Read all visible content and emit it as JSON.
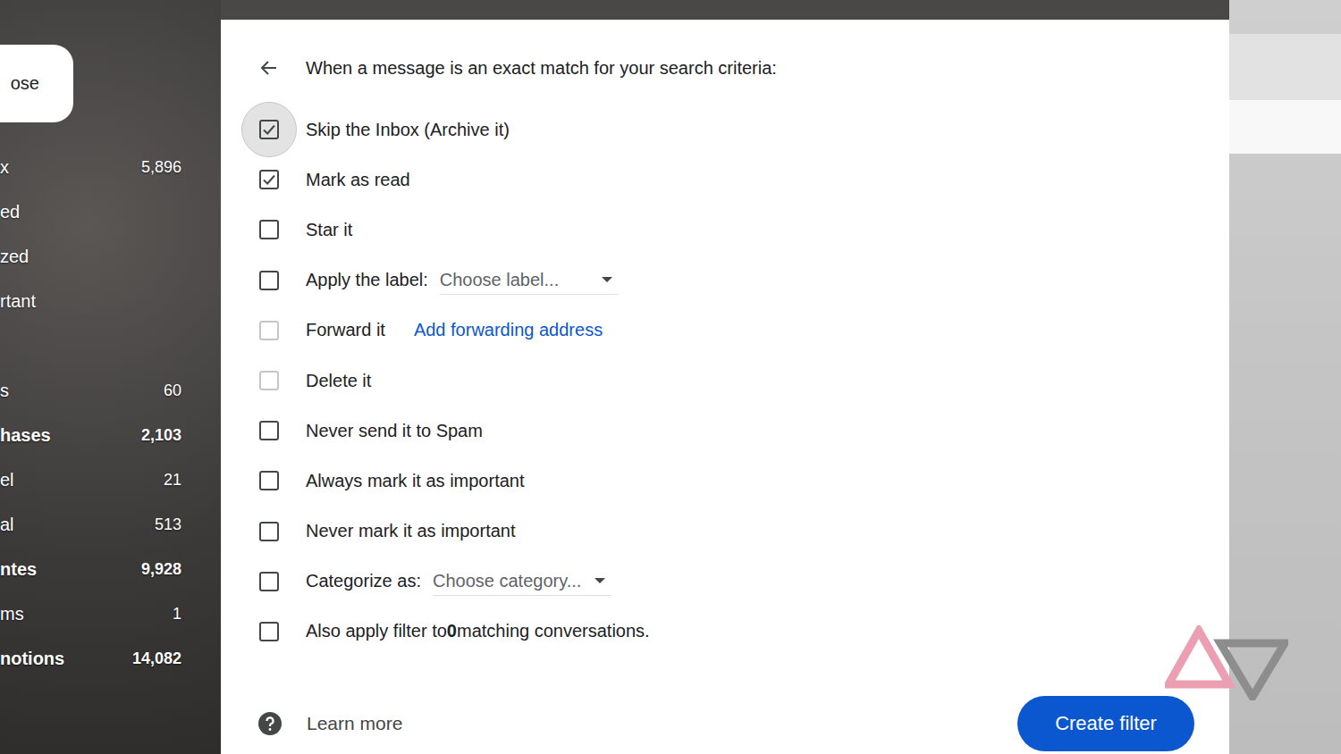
{
  "sidebar": {
    "compose": "ose",
    "items": [
      {
        "label": "x",
        "count": "5,896",
        "bold": false
      },
      {
        "label": "ed",
        "count": "",
        "bold": false
      },
      {
        "label": "zed",
        "count": "",
        "bold": false
      },
      {
        "label": "rtant",
        "count": "",
        "bold": false
      }
    ],
    "labels": [
      {
        "label": "s",
        "count": "60",
        "bold": false
      },
      {
        "label": "hases",
        "count": "2,103",
        "bold": true
      },
      {
        "label": "el",
        "count": "21",
        "bold": false
      },
      {
        "label": "al",
        "count": "513",
        "bold": false
      },
      {
        "label": "ntes",
        "count": "9,928",
        "bold": true
      },
      {
        "label": "ms",
        "count": "1",
        "bold": false
      },
      {
        "label": "notions",
        "count": "14,082",
        "bold": true
      }
    ]
  },
  "dialog": {
    "heading": "When a message is an exact match for your search criteria:",
    "actions": [
      {
        "kind": "checkbox",
        "label": "Skip the Inbox (Archive it)",
        "checked": true,
        "disabled": false,
        "hovered": true
      },
      {
        "kind": "checkbox",
        "label": "Mark as read",
        "checked": true,
        "disabled": false,
        "hovered": false
      },
      {
        "kind": "checkbox",
        "label": "Star it",
        "checked": false,
        "disabled": false,
        "hovered": false
      },
      {
        "kind": "select",
        "label": "Apply the label:",
        "value": "Choose label...",
        "checked": false,
        "disabled": false,
        "hovered": false
      },
      {
        "kind": "link",
        "label": "Forward it",
        "link": "Add forwarding address",
        "checked": false,
        "disabled": true,
        "hovered": false
      },
      {
        "kind": "checkbox",
        "label": "Delete it",
        "checked": false,
        "disabled": true,
        "hovered": false
      },
      {
        "kind": "checkbox",
        "label": "Never send it to Spam",
        "checked": false,
        "disabled": false,
        "hovered": false
      },
      {
        "kind": "checkbox",
        "label": "Always mark it as important",
        "checked": false,
        "disabled": false,
        "hovered": false
      },
      {
        "kind": "checkbox",
        "label": "Never mark it as important",
        "checked": false,
        "disabled": false,
        "hovered": false
      },
      {
        "kind": "select",
        "label": "Categorize as:",
        "value": "Choose category...",
        "checked": false,
        "disabled": false,
        "hovered": false
      },
      {
        "kind": "count",
        "prefix": "Also apply filter to ",
        "count": "0",
        "suffix": " matching conversations.",
        "checked": false,
        "disabled": false,
        "hovered": false
      }
    ],
    "learn_more": "Learn more",
    "button": "Create filter"
  }
}
